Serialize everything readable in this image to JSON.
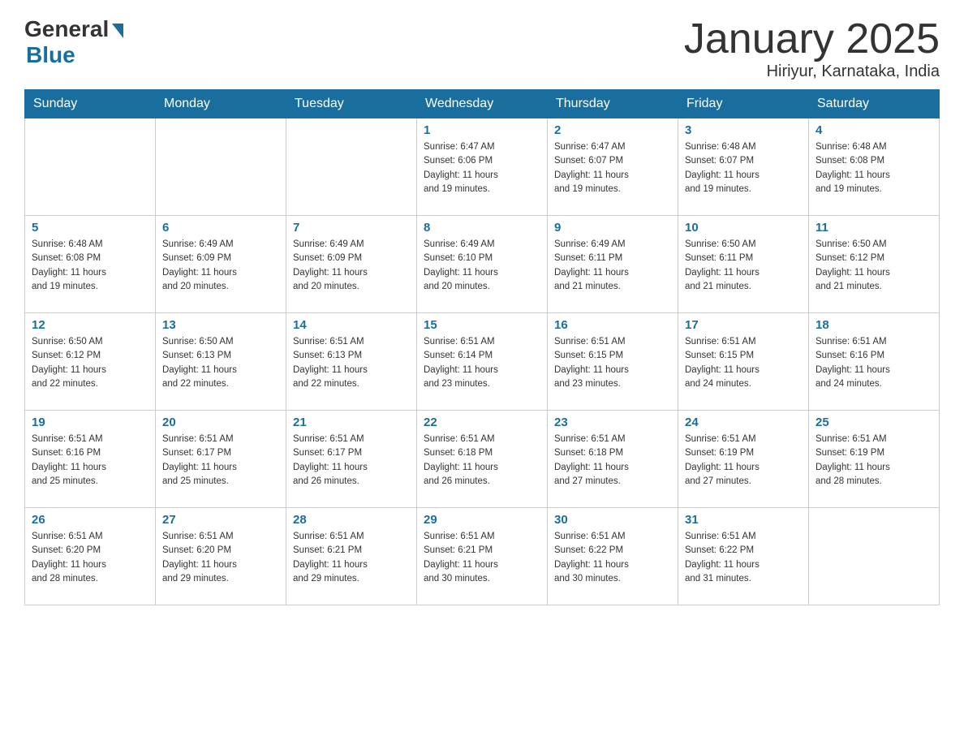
{
  "logo": {
    "general": "General",
    "blue": "Blue"
  },
  "title": "January 2025",
  "location": "Hiriyur, Karnataka, India",
  "days_of_week": [
    "Sunday",
    "Monday",
    "Tuesday",
    "Wednesday",
    "Thursday",
    "Friday",
    "Saturday"
  ],
  "weeks": [
    [
      {
        "day": "",
        "info": ""
      },
      {
        "day": "",
        "info": ""
      },
      {
        "day": "",
        "info": ""
      },
      {
        "day": "1",
        "info": "Sunrise: 6:47 AM\nSunset: 6:06 PM\nDaylight: 11 hours\nand 19 minutes."
      },
      {
        "day": "2",
        "info": "Sunrise: 6:47 AM\nSunset: 6:07 PM\nDaylight: 11 hours\nand 19 minutes."
      },
      {
        "day": "3",
        "info": "Sunrise: 6:48 AM\nSunset: 6:07 PM\nDaylight: 11 hours\nand 19 minutes."
      },
      {
        "day": "4",
        "info": "Sunrise: 6:48 AM\nSunset: 6:08 PM\nDaylight: 11 hours\nand 19 minutes."
      }
    ],
    [
      {
        "day": "5",
        "info": "Sunrise: 6:48 AM\nSunset: 6:08 PM\nDaylight: 11 hours\nand 19 minutes."
      },
      {
        "day": "6",
        "info": "Sunrise: 6:49 AM\nSunset: 6:09 PM\nDaylight: 11 hours\nand 20 minutes."
      },
      {
        "day": "7",
        "info": "Sunrise: 6:49 AM\nSunset: 6:09 PM\nDaylight: 11 hours\nand 20 minutes."
      },
      {
        "day": "8",
        "info": "Sunrise: 6:49 AM\nSunset: 6:10 PM\nDaylight: 11 hours\nand 20 minutes."
      },
      {
        "day": "9",
        "info": "Sunrise: 6:49 AM\nSunset: 6:11 PM\nDaylight: 11 hours\nand 21 minutes."
      },
      {
        "day": "10",
        "info": "Sunrise: 6:50 AM\nSunset: 6:11 PM\nDaylight: 11 hours\nand 21 minutes."
      },
      {
        "day": "11",
        "info": "Sunrise: 6:50 AM\nSunset: 6:12 PM\nDaylight: 11 hours\nand 21 minutes."
      }
    ],
    [
      {
        "day": "12",
        "info": "Sunrise: 6:50 AM\nSunset: 6:12 PM\nDaylight: 11 hours\nand 22 minutes."
      },
      {
        "day": "13",
        "info": "Sunrise: 6:50 AM\nSunset: 6:13 PM\nDaylight: 11 hours\nand 22 minutes."
      },
      {
        "day": "14",
        "info": "Sunrise: 6:51 AM\nSunset: 6:13 PM\nDaylight: 11 hours\nand 22 minutes."
      },
      {
        "day": "15",
        "info": "Sunrise: 6:51 AM\nSunset: 6:14 PM\nDaylight: 11 hours\nand 23 minutes."
      },
      {
        "day": "16",
        "info": "Sunrise: 6:51 AM\nSunset: 6:15 PM\nDaylight: 11 hours\nand 23 minutes."
      },
      {
        "day": "17",
        "info": "Sunrise: 6:51 AM\nSunset: 6:15 PM\nDaylight: 11 hours\nand 24 minutes."
      },
      {
        "day": "18",
        "info": "Sunrise: 6:51 AM\nSunset: 6:16 PM\nDaylight: 11 hours\nand 24 minutes."
      }
    ],
    [
      {
        "day": "19",
        "info": "Sunrise: 6:51 AM\nSunset: 6:16 PM\nDaylight: 11 hours\nand 25 minutes."
      },
      {
        "day": "20",
        "info": "Sunrise: 6:51 AM\nSunset: 6:17 PM\nDaylight: 11 hours\nand 25 minutes."
      },
      {
        "day": "21",
        "info": "Sunrise: 6:51 AM\nSunset: 6:17 PM\nDaylight: 11 hours\nand 26 minutes."
      },
      {
        "day": "22",
        "info": "Sunrise: 6:51 AM\nSunset: 6:18 PM\nDaylight: 11 hours\nand 26 minutes."
      },
      {
        "day": "23",
        "info": "Sunrise: 6:51 AM\nSunset: 6:18 PM\nDaylight: 11 hours\nand 27 minutes."
      },
      {
        "day": "24",
        "info": "Sunrise: 6:51 AM\nSunset: 6:19 PM\nDaylight: 11 hours\nand 27 minutes."
      },
      {
        "day": "25",
        "info": "Sunrise: 6:51 AM\nSunset: 6:19 PM\nDaylight: 11 hours\nand 28 minutes."
      }
    ],
    [
      {
        "day": "26",
        "info": "Sunrise: 6:51 AM\nSunset: 6:20 PM\nDaylight: 11 hours\nand 28 minutes."
      },
      {
        "day": "27",
        "info": "Sunrise: 6:51 AM\nSunset: 6:20 PM\nDaylight: 11 hours\nand 29 minutes."
      },
      {
        "day": "28",
        "info": "Sunrise: 6:51 AM\nSunset: 6:21 PM\nDaylight: 11 hours\nand 29 minutes."
      },
      {
        "day": "29",
        "info": "Sunrise: 6:51 AM\nSunset: 6:21 PM\nDaylight: 11 hours\nand 30 minutes."
      },
      {
        "day": "30",
        "info": "Sunrise: 6:51 AM\nSunset: 6:22 PM\nDaylight: 11 hours\nand 30 minutes."
      },
      {
        "day": "31",
        "info": "Sunrise: 6:51 AM\nSunset: 6:22 PM\nDaylight: 11 hours\nand 31 minutes."
      },
      {
        "day": "",
        "info": ""
      }
    ]
  ]
}
